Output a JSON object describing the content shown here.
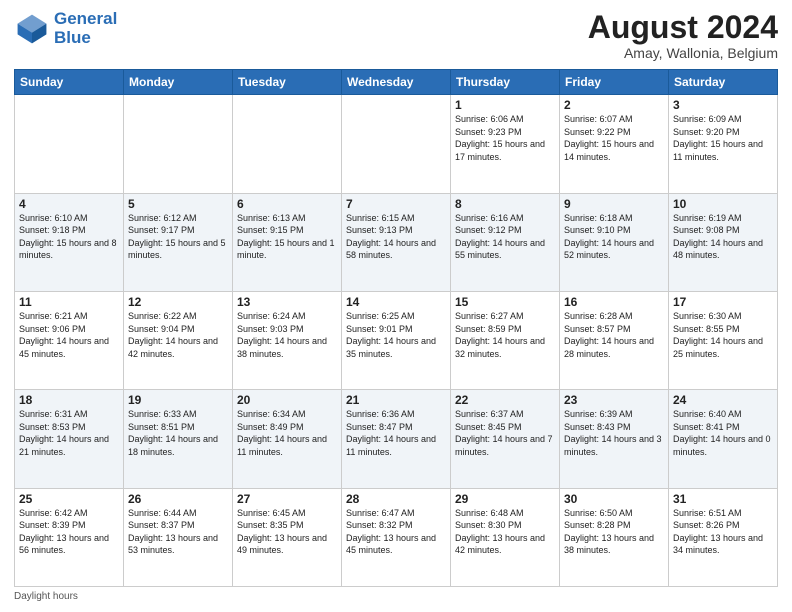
{
  "header": {
    "logo_line1": "General",
    "logo_line2": "Blue",
    "month_year": "August 2024",
    "location": "Amay, Wallonia, Belgium"
  },
  "footer": {
    "daylight_label": "Daylight hours"
  },
  "weekdays": [
    "Sunday",
    "Monday",
    "Tuesday",
    "Wednesday",
    "Thursday",
    "Friday",
    "Saturday"
  ],
  "weeks": [
    [
      {
        "day": "",
        "info": ""
      },
      {
        "day": "",
        "info": ""
      },
      {
        "day": "",
        "info": ""
      },
      {
        "day": "",
        "info": ""
      },
      {
        "day": "1",
        "info": "Sunrise: 6:06 AM\nSunset: 9:23 PM\nDaylight: 15 hours\nand 17 minutes."
      },
      {
        "day": "2",
        "info": "Sunrise: 6:07 AM\nSunset: 9:22 PM\nDaylight: 15 hours\nand 14 minutes."
      },
      {
        "day": "3",
        "info": "Sunrise: 6:09 AM\nSunset: 9:20 PM\nDaylight: 15 hours\nand 11 minutes."
      }
    ],
    [
      {
        "day": "4",
        "info": "Sunrise: 6:10 AM\nSunset: 9:18 PM\nDaylight: 15 hours\nand 8 minutes."
      },
      {
        "day": "5",
        "info": "Sunrise: 6:12 AM\nSunset: 9:17 PM\nDaylight: 15 hours\nand 5 minutes."
      },
      {
        "day": "6",
        "info": "Sunrise: 6:13 AM\nSunset: 9:15 PM\nDaylight: 15 hours\nand 1 minute."
      },
      {
        "day": "7",
        "info": "Sunrise: 6:15 AM\nSunset: 9:13 PM\nDaylight: 14 hours\nand 58 minutes."
      },
      {
        "day": "8",
        "info": "Sunrise: 6:16 AM\nSunset: 9:12 PM\nDaylight: 14 hours\nand 55 minutes."
      },
      {
        "day": "9",
        "info": "Sunrise: 6:18 AM\nSunset: 9:10 PM\nDaylight: 14 hours\nand 52 minutes."
      },
      {
        "day": "10",
        "info": "Sunrise: 6:19 AM\nSunset: 9:08 PM\nDaylight: 14 hours\nand 48 minutes."
      }
    ],
    [
      {
        "day": "11",
        "info": "Sunrise: 6:21 AM\nSunset: 9:06 PM\nDaylight: 14 hours\nand 45 minutes."
      },
      {
        "day": "12",
        "info": "Sunrise: 6:22 AM\nSunset: 9:04 PM\nDaylight: 14 hours\nand 42 minutes."
      },
      {
        "day": "13",
        "info": "Sunrise: 6:24 AM\nSunset: 9:03 PM\nDaylight: 14 hours\nand 38 minutes."
      },
      {
        "day": "14",
        "info": "Sunrise: 6:25 AM\nSunset: 9:01 PM\nDaylight: 14 hours\nand 35 minutes."
      },
      {
        "day": "15",
        "info": "Sunrise: 6:27 AM\nSunset: 8:59 PM\nDaylight: 14 hours\nand 32 minutes."
      },
      {
        "day": "16",
        "info": "Sunrise: 6:28 AM\nSunset: 8:57 PM\nDaylight: 14 hours\nand 28 minutes."
      },
      {
        "day": "17",
        "info": "Sunrise: 6:30 AM\nSunset: 8:55 PM\nDaylight: 14 hours\nand 25 minutes."
      }
    ],
    [
      {
        "day": "18",
        "info": "Sunrise: 6:31 AM\nSunset: 8:53 PM\nDaylight: 14 hours\nand 21 minutes."
      },
      {
        "day": "19",
        "info": "Sunrise: 6:33 AM\nSunset: 8:51 PM\nDaylight: 14 hours\nand 18 minutes."
      },
      {
        "day": "20",
        "info": "Sunrise: 6:34 AM\nSunset: 8:49 PM\nDaylight: 14 hours\nand 11 minutes."
      },
      {
        "day": "21",
        "info": "Sunrise: 6:36 AM\nSunset: 8:47 PM\nDaylight: 14 hours\nand 11 minutes."
      },
      {
        "day": "22",
        "info": "Sunrise: 6:37 AM\nSunset: 8:45 PM\nDaylight: 14 hours\nand 7 minutes."
      },
      {
        "day": "23",
        "info": "Sunrise: 6:39 AM\nSunset: 8:43 PM\nDaylight: 14 hours\nand 3 minutes."
      },
      {
        "day": "24",
        "info": "Sunrise: 6:40 AM\nSunset: 8:41 PM\nDaylight: 14 hours\nand 0 minutes."
      }
    ],
    [
      {
        "day": "25",
        "info": "Sunrise: 6:42 AM\nSunset: 8:39 PM\nDaylight: 13 hours\nand 56 minutes."
      },
      {
        "day": "26",
        "info": "Sunrise: 6:44 AM\nSunset: 8:37 PM\nDaylight: 13 hours\nand 53 minutes."
      },
      {
        "day": "27",
        "info": "Sunrise: 6:45 AM\nSunset: 8:35 PM\nDaylight: 13 hours\nand 49 minutes."
      },
      {
        "day": "28",
        "info": "Sunrise: 6:47 AM\nSunset: 8:32 PM\nDaylight: 13 hours\nand 45 minutes."
      },
      {
        "day": "29",
        "info": "Sunrise: 6:48 AM\nSunset: 8:30 PM\nDaylight: 13 hours\nand 42 minutes."
      },
      {
        "day": "30",
        "info": "Sunrise: 6:50 AM\nSunset: 8:28 PM\nDaylight: 13 hours\nand 38 minutes."
      },
      {
        "day": "31",
        "info": "Sunrise: 6:51 AM\nSunset: 8:26 PM\nDaylight: 13 hours\nand 34 minutes."
      }
    ]
  ]
}
